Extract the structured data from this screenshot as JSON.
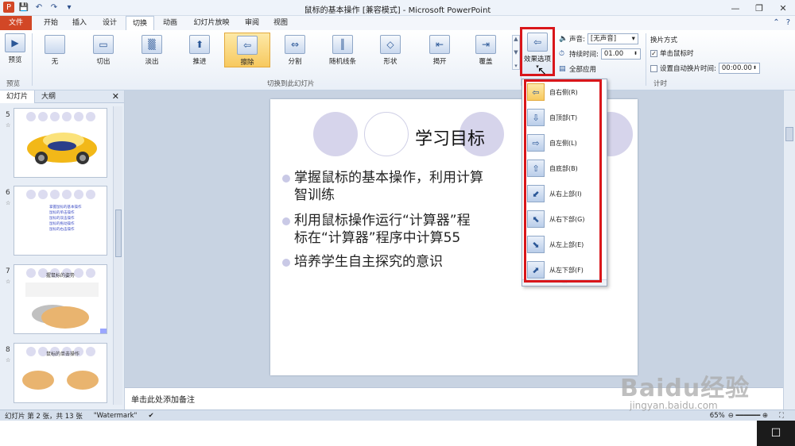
{
  "window": {
    "title": "鼠标的基本操作 [兼容模式] - Microsoft PowerPoint"
  },
  "tabs": [
    "文件",
    "开始",
    "插入",
    "设计",
    "切换",
    "动画",
    "幻灯片放映",
    "审阅",
    "视图"
  ],
  "active_tab": "切换",
  "ribbon": {
    "preview_label": "预览",
    "preview_group": "预览",
    "transitions": [
      "无",
      "切出",
      "淡出",
      "推进",
      "擦除",
      "分割",
      "随机线条",
      "形状",
      "揭开",
      "覆盖"
    ],
    "selected_transition": "擦除",
    "transitions_group": "切换到此幻灯片",
    "effect_options_label": "效果选项",
    "sound_label": "声音:",
    "sound_value": "[无声音]",
    "duration_label": "持续时间:",
    "duration_value": "01.00",
    "apply_all_label": "全部应用",
    "advance_header": "换片方式",
    "on_click_label": "单击鼠标时",
    "on_click_checked": true,
    "auto_advance_label": "设置自动换片时间:",
    "auto_advance_value": "00:00.00",
    "timing_group": "计时"
  },
  "left_panel": {
    "tabs": [
      "幻灯片",
      "大纲"
    ],
    "close_icon": "✕",
    "slides": [
      {
        "number": "5",
        "star": "☆"
      },
      {
        "number": "6",
        "star": "☆",
        "items": [
          "掌握鼠标的基本操作",
          "鼠标的单击操作",
          "鼠标的双击操作",
          "鼠标的拖动操作",
          "鼠标的右击操作"
        ]
      },
      {
        "number": "7",
        "star": "☆",
        "title": "握鼠标的姿势"
      },
      {
        "number": "8",
        "star": "☆",
        "title": "鼠标的单击操作"
      }
    ]
  },
  "slide": {
    "title": "学习目标",
    "bullets": [
      "掌握鼠标的基本操作，利用计算",
      "智训练",
      "利用鼠标操作运行“计算器”程",
      "标在“计算器”程序中计算55",
      "培养学生自主探究的意识"
    ]
  },
  "notes_placeholder": "单击此处添加备注",
  "effect_options": [
    {
      "label": "自右侧(R)",
      "icon": "⇦"
    },
    {
      "label": "自顶部(T)",
      "icon": "⇩"
    },
    {
      "label": "自左侧(L)",
      "icon": "⇨"
    },
    {
      "label": "自底部(B)",
      "icon": "⇧"
    },
    {
      "label": "从右上部(I)",
      "icon": "⬋"
    },
    {
      "label": "从右下部(G)",
      "icon": "⬉"
    },
    {
      "label": "从左上部(E)",
      "icon": "⬊"
    },
    {
      "label": "从左下部(F)",
      "icon": "⬈"
    }
  ],
  "selected_effect": "自右侧(R)",
  "statusbar": {
    "slide_info": "幻灯片 第 2 张，共 13 张",
    "theme": "\"Watermark\"",
    "zoom": "65%"
  },
  "watermark": {
    "brand": "Baidu经验",
    "url": "jingyan.baidu.com"
  },
  "colors": {
    "file_tab": "#d24726",
    "highlight_red": "#d9161a",
    "selected_gold": "#f7c95f"
  }
}
